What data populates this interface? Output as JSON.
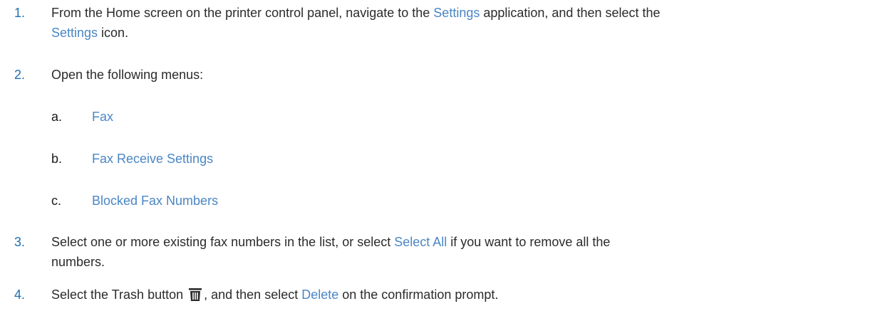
{
  "steps": [
    {
      "number": "1.",
      "parts": {
        "a": "From the Home screen on the printer control panel, navigate to the ",
        "b": "Settings",
        "c": " application, and then select the",
        "d": "Settings",
        "e": " icon."
      }
    },
    {
      "number": "2.",
      "parts": {
        "a": "Open the following menus:"
      },
      "substeps": [
        {
          "letter": "a.",
          "label": "Fax"
        },
        {
          "letter": "b.",
          "label": "Fax Receive Settings"
        },
        {
          "letter": "c.",
          "label": "Blocked Fax Numbers"
        }
      ]
    },
    {
      "number": "3.",
      "parts": {
        "a": "Select one or more existing fax numbers in the list, or select ",
        "b": "Select All",
        "c": " if you want to remove all the",
        "d": "numbers."
      }
    },
    {
      "number": "4.",
      "parts": {
        "a": "Select the Trash button ",
        "b": ", and then select ",
        "c": "Delete",
        "d": " on the confirmation prompt."
      },
      "icon": "trash-icon"
    }
  ],
  "colors": {
    "step_number": "#1f6fb2",
    "ui_term": "#4a86c5",
    "text": "#2b2b2b"
  }
}
